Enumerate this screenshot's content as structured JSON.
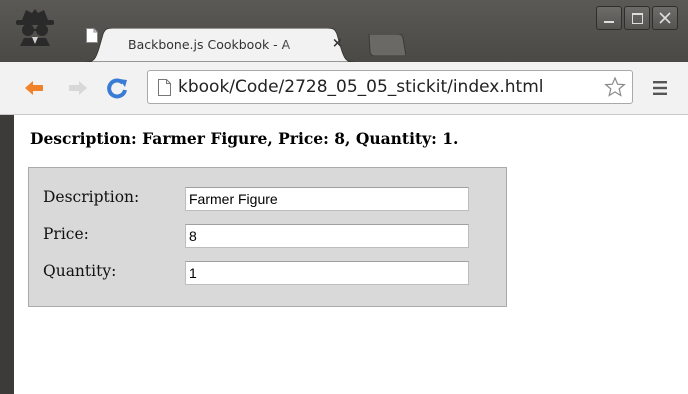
{
  "tab": {
    "title": "Backbone.js Cookbook - A",
    "close": "×"
  },
  "omnibox": {
    "url": "kbook/Code/2728_05_05_stickit/index.html"
  },
  "page": {
    "heading": "Description: Farmer Figure, Price: 8, Quantity: 1.",
    "form": {
      "description_label": "Description:",
      "description_value": "Farmer Figure",
      "price_label": "Price:",
      "price_value": "8",
      "quantity_label": "Quantity:",
      "quantity_value": "1"
    }
  },
  "icons": {
    "incognito": "incognito-icon",
    "back": "back-arrow-icon",
    "forward": "forward-arrow-icon",
    "reload": "reload-icon",
    "page": "page-icon",
    "star": "star-icon",
    "menu": "menu-icon"
  },
  "colors": {
    "back_arrow": "#f0832a",
    "reload": "#3a7bd5",
    "titlebar": "#4f4e4a"
  }
}
